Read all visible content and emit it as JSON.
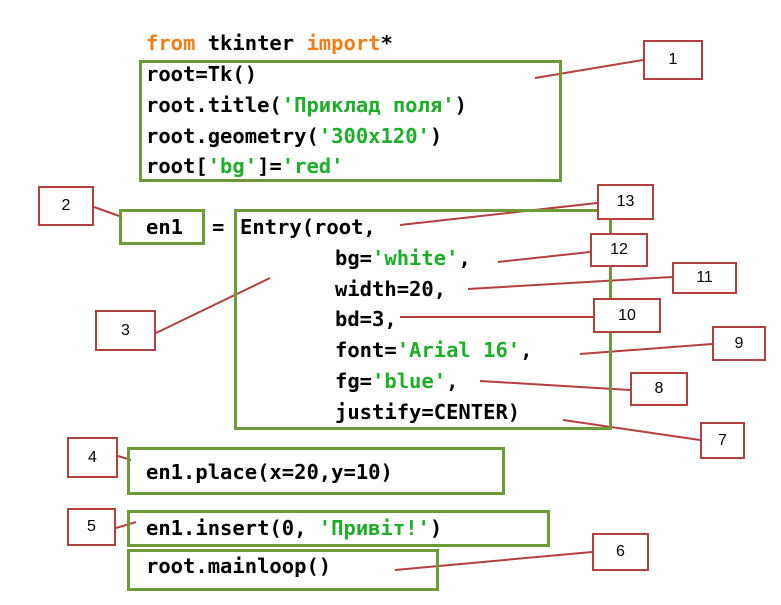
{
  "code": {
    "import": {
      "kw1": "from",
      "mid": " tkinter ",
      "kw2": "import",
      "end": "*"
    },
    "l_root_tk": "root=Tk()",
    "l_title": {
      "pre": "root.title(",
      "str": "'Приклад поля'",
      "post": ")"
    },
    "l_geometry": {
      "pre": "root.geometry(",
      "str": "'300x120'",
      "post": ")"
    },
    "l_bg": {
      "pre": "root[",
      "str1": "'bg'",
      "mid": "]=",
      "str2": "'red'"
    },
    "l_en1": "en1",
    "l_eq": "=",
    "l_entry": "Entry(root,",
    "l_bgw": {
      "pre": "bg=",
      "str": "'white'",
      "post": ","
    },
    "l_width": "width=20,",
    "l_bd": "bd=3,",
    "l_font": {
      "pre": "font=",
      "str": "'Arial 16'",
      "post": ","
    },
    "l_fg": {
      "pre": "fg=",
      "str": "'blue'",
      "post": ","
    },
    "l_justify": "justify=CENTER)",
    "l_place": "en1.place(x=20,y=10)",
    "l_insert": {
      "pre": "en1.insert(0, ",
      "str": "'Привіт!'",
      "post": ")"
    },
    "l_mainloop": "root.mainloop()"
  },
  "labels": {
    "n1": "1",
    "n2": "2",
    "n3": "3",
    "n4": "4",
    "n5": "5",
    "n6": "6",
    "n7": "7",
    "n8": "8",
    "n9": "9",
    "n10": "10",
    "n11": "11",
    "n12": "12",
    "n13": "13"
  },
  "colors": {
    "keyword": "#f07f1a",
    "string": "#1fae2a",
    "group_border": "#6f9a3a",
    "callout_border": "#b24040"
  }
}
